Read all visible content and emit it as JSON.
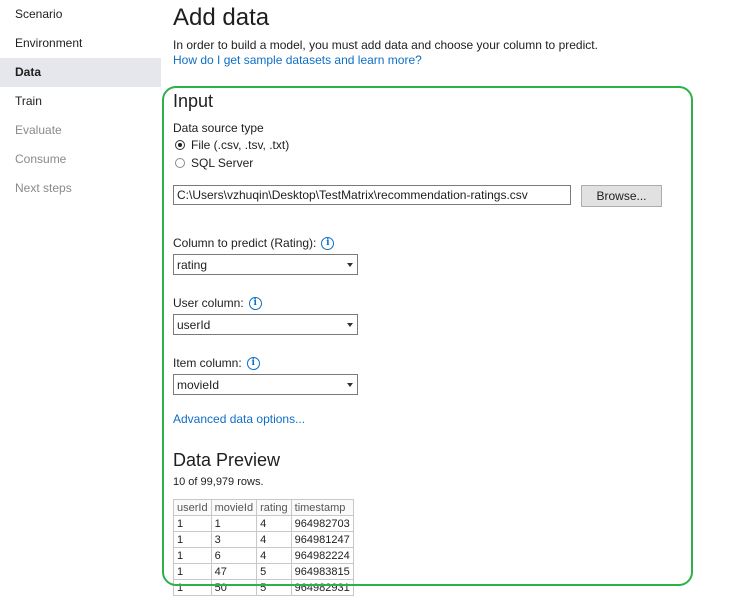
{
  "sidebar": {
    "items": [
      {
        "label": "Scenario",
        "state": "normal"
      },
      {
        "label": "Environment",
        "state": "normal"
      },
      {
        "label": "Data",
        "state": "active"
      },
      {
        "label": "Train",
        "state": "normal"
      },
      {
        "label": "Evaluate",
        "state": "disabled"
      },
      {
        "label": "Consume",
        "state": "disabled"
      },
      {
        "label": "Next steps",
        "state": "disabled"
      }
    ]
  },
  "main": {
    "title": "Add data",
    "description": "In order to build a model, you must add data and choose your column to predict.",
    "help_link": "How do I get sample datasets and learn more?",
    "input": {
      "title": "Input",
      "source_type_label": "Data source type",
      "options": [
        {
          "label": "File (.csv, .tsv, .txt)",
          "checked": true
        },
        {
          "label": "SQL Server",
          "checked": false
        }
      ],
      "file_path": "C:\\Users\\vzhuqin\\Desktop\\TestMatrix\\recommendation-ratings.csv",
      "browse_label": "Browse...",
      "predict_label": "Column to predict (Rating):",
      "predict_value": "rating",
      "user_label": "User column:",
      "user_value": "userId",
      "item_label": "Item column:",
      "item_value": "movieId",
      "advanced_link": "Advanced data options..."
    },
    "preview": {
      "title": "Data Preview",
      "rows_text": "10 of 99,979 rows.",
      "columns": [
        "userId",
        "movieId",
        "rating",
        "timestamp"
      ],
      "rows": [
        [
          "1",
          "1",
          "4",
          "964982703"
        ],
        [
          "1",
          "3",
          "4",
          "964981247"
        ],
        [
          "1",
          "6",
          "4",
          "964982224"
        ],
        [
          "1",
          "47",
          "5",
          "964983815"
        ],
        [
          "1",
          "50",
          "5",
          "964982931"
        ]
      ]
    }
  },
  "colors": {
    "accent_link": "#0e6fc5",
    "highlight_border": "#2db24a",
    "active_nav_bg": "#e6e7ed"
  }
}
